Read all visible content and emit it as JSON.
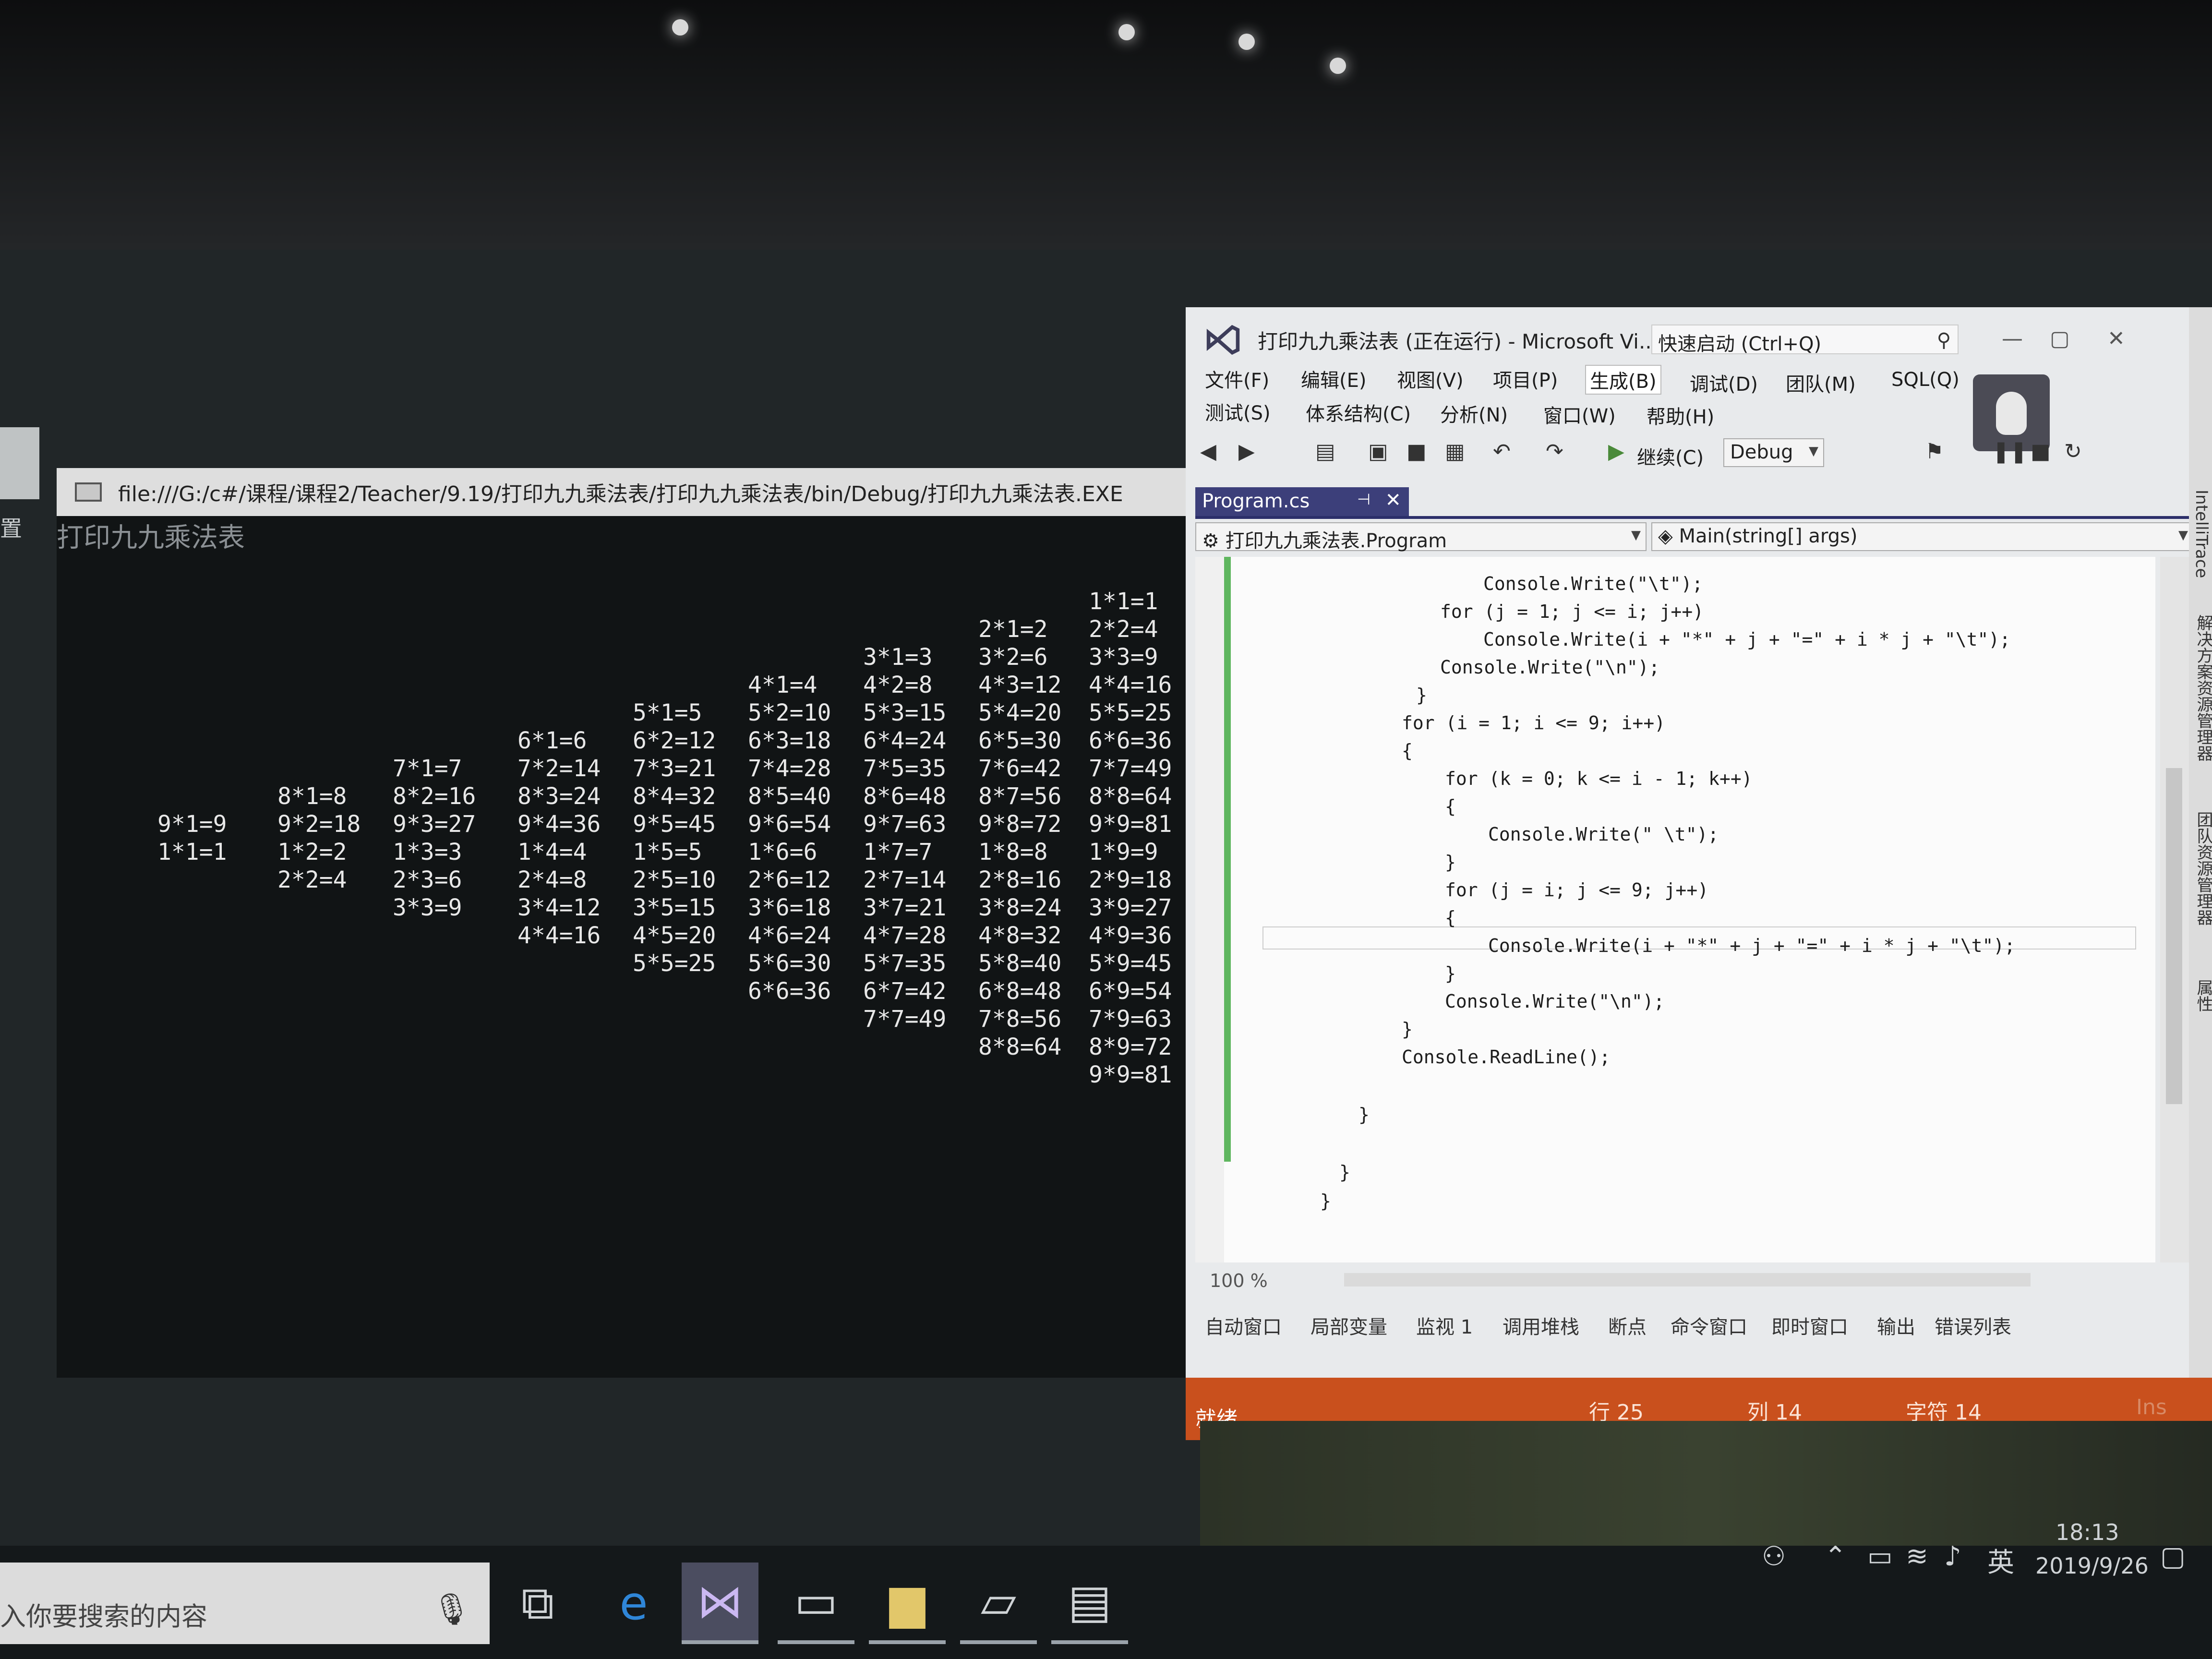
{
  "console": {
    "title": "file:///G:/c#/课程/课程2/Teacher/9.19/打印九九乘法表/打印九九乘法表/bin/Debug/打印九九乘法表.EXE",
    "first_line": "打印九九乘法表",
    "table_upper": [
      [
        "9*1=9"
      ],
      [
        "8*1=8",
        "9*2=18"
      ],
      [
        "7*1=7",
        "8*2=16",
        "9*3=27"
      ],
      [
        "6*1=6",
        "7*2=14",
        "8*3=24",
        "9*4=36"
      ],
      [
        "5*1=5",
        "6*2=12",
        "7*3=21",
        "8*4=32",
        "9*5=45"
      ],
      [
        "4*1=4",
        "5*2=10",
        "6*3=18",
        "7*4=28",
        "8*5=40",
        "9*6=54"
      ],
      [
        "3*1=3",
        "4*2=8",
        "5*3=15",
        "6*4=24",
        "7*5=35",
        "8*6=48",
        "9*7=63"
      ],
      [
        "2*1=2",
        "3*2=6",
        "4*3=12",
        "5*4=20",
        "6*5=30",
        "7*6=42",
        "8*7=56",
        "9*8=72"
      ],
      [
        "1*1=1",
        "2*2=4",
        "3*3=9",
        "4*4=16",
        "5*5=25",
        "6*6=36",
        "7*7=49",
        "8*8=64",
        "9*9=81"
      ]
    ],
    "table_lower": [
      [
        "1*1=1"
      ],
      [
        "1*2=2",
        "2*2=4"
      ],
      [
        "1*3=3",
        "2*3=6",
        "3*3=9"
      ],
      [
        "1*4=4",
        "2*4=8",
        "3*4=12",
        "4*4=16"
      ],
      [
        "1*5=5",
        "2*5=10",
        "3*5=15",
        "4*5=20",
        "5*5=25"
      ],
      [
        "1*6=6",
        "2*6=12",
        "3*6=18",
        "4*6=24",
        "5*6=30",
        "6*6=36"
      ],
      [
        "1*7=7",
        "2*7=14",
        "3*7=21",
        "4*7=28",
        "5*7=35",
        "6*7=42",
        "7*7=49"
      ],
      [
        "1*8=8",
        "2*8=16",
        "3*8=24",
        "4*8=32",
        "5*8=40",
        "6*8=48",
        "7*8=56",
        "8*8=64"
      ],
      [
        "1*9=9",
        "2*9=18",
        "3*9=27",
        "4*9=36",
        "5*9=45",
        "6*9=54",
        "7*9=63",
        "8*9=72",
        "9*9=81"
      ]
    ]
  },
  "desktop": {
    "side_label": "置"
  },
  "vs": {
    "title": "打印九九乘法表 (正在运行) - Microsoft Vi...",
    "quick_launch": "快速启动 (Ctrl+Q)",
    "menu_row1": [
      "文件(F)",
      "编辑(E)",
      "视图(V)",
      "项目(P)",
      "生成(B)",
      "调试(D)",
      "团队(M)",
      "SQL(Q)"
    ],
    "menu_row2": [
      "测试(S)",
      "体系结构(C)",
      "分析(N)",
      "窗口(W)",
      "帮助(H)"
    ],
    "active_menu": "生成(B)",
    "continue_label": "继续(C)",
    "config": "Debug",
    "tab_label": "Program.cs",
    "nav_left": "打印九九乘法表.Program",
    "nav_right": "Main(string[] args)",
    "code": [
      "Console.Write(\"\\t\");",
      "for (j = 1; j <= i; j++)",
      "Console.Write(i + \"*\" + j + \"=\" + i * j + \"\\t\");",
      "Console.Write(\"\\n\");",
      "}",
      "for (i = 1; i <= 9; i++)",
      "{",
      "for (k = 0; k <= i - 1; k++)",
      "{",
      "Console.Write(\" \\t\");",
      "}",
      "for (j = i; j <= 9; j++)",
      "{",
      "Console.Write(i + \"*\" + j + \"=\" + i * j + \"\\t\");",
      "}",
      "Console.Write(\"\\n\");",
      "}",
      "Console.ReadLine();",
      "}",
      "}",
      "}"
    ],
    "zoom": "100 %",
    "bottom_tabs": [
      "自动窗口",
      "局部变量",
      "监视 1",
      "调用堆栈",
      "断点",
      "命令窗口",
      "即时窗口",
      "输出",
      "错误列表"
    ],
    "right_rail": [
      "IntelliTrace",
      "解决方案资源管理器",
      "团队资源管理器",
      "属性"
    ],
    "status": {
      "ready": "就绪",
      "row": "行 25",
      "col": "列 14",
      "char": "字符 14",
      "ins": "Ins"
    },
    "accent_color": "#3c3f7a",
    "status_color": "#c9501d"
  },
  "taskbar": {
    "search_placeholder": "入你要搜索的内容",
    "icons": [
      "task-view-icon",
      "edge-icon",
      "visual-studio-icon",
      "computer-icon",
      "file-explorer-icon",
      "document-icon",
      "notepad-icon"
    ],
    "tray_lang": "英",
    "time": "18:13",
    "date": "2019/9/26"
  }
}
